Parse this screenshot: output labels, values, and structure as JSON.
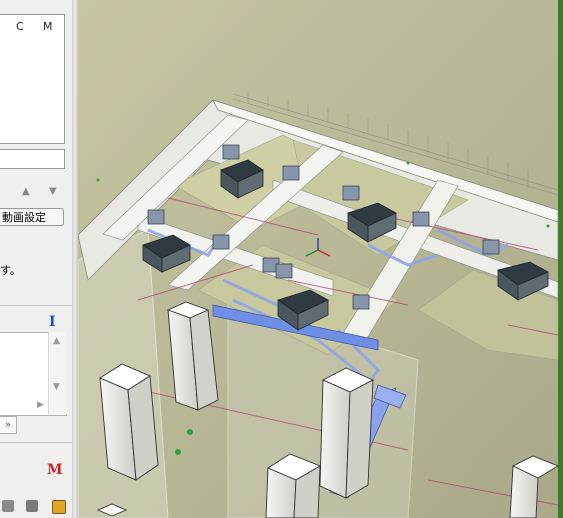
{
  "left_panel": {
    "columns": [
      "C",
      "M"
    ],
    "button_label": "動画設定",
    "message": "す。",
    "chevron_label": "»",
    "text_icon": "I",
    "m_icon": "M"
  },
  "icons": {
    "up_arrow": "▲",
    "down_arrow": "▼",
    "scroll_up": "▲",
    "scroll_down": "▼",
    "scroll_right": "▶"
  },
  "colors": {
    "viewport_bg": "#b9b99a",
    "floor": "#cfcfa6",
    "slab": "#f1f1ec",
    "equipment": "#3e4a50",
    "duct": "#a9b9ee",
    "accent_red": "#d21c1c"
  }
}
